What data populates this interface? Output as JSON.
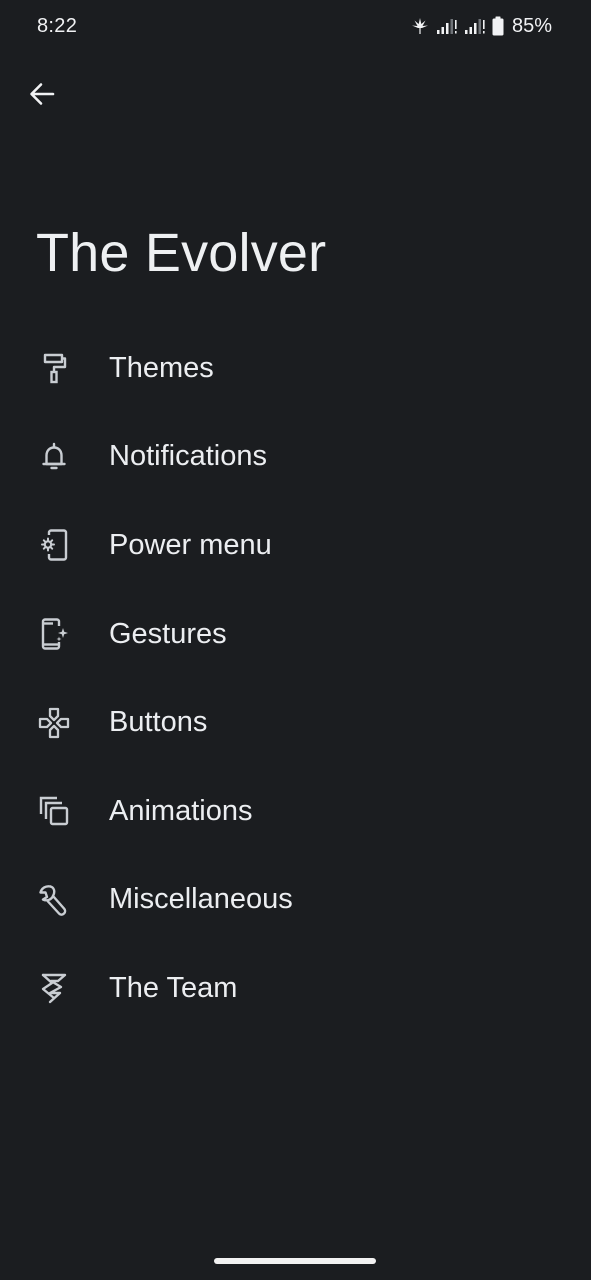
{
  "status_bar": {
    "time": "8:22",
    "battery_percent": "85%",
    "icons": [
      "leaf-icon",
      "signal-icon",
      "signal-icon",
      "battery-icon"
    ]
  },
  "header": {
    "back_icon": "arrow-left-icon",
    "title": "The Evolver"
  },
  "menu": {
    "items": [
      {
        "label": "Themes",
        "icon": "paint-roller-icon"
      },
      {
        "label": "Notifications",
        "icon": "bell-icon"
      },
      {
        "label": "Power menu",
        "icon": "phone-settings-icon"
      },
      {
        "label": "Gestures",
        "icon": "phone-sparkle-icon"
      },
      {
        "label": "Buttons",
        "icon": "gamepad-icon"
      },
      {
        "label": "Animations",
        "icon": "layers-icon"
      },
      {
        "label": "Miscellaneous",
        "icon": "wrench-icon"
      },
      {
        "label": "The Team",
        "icon": "evolution-logo-icon"
      }
    ]
  },
  "colors": {
    "background": "#1b1d20",
    "text": "#eceef1",
    "icon": "#c9cdd2"
  }
}
